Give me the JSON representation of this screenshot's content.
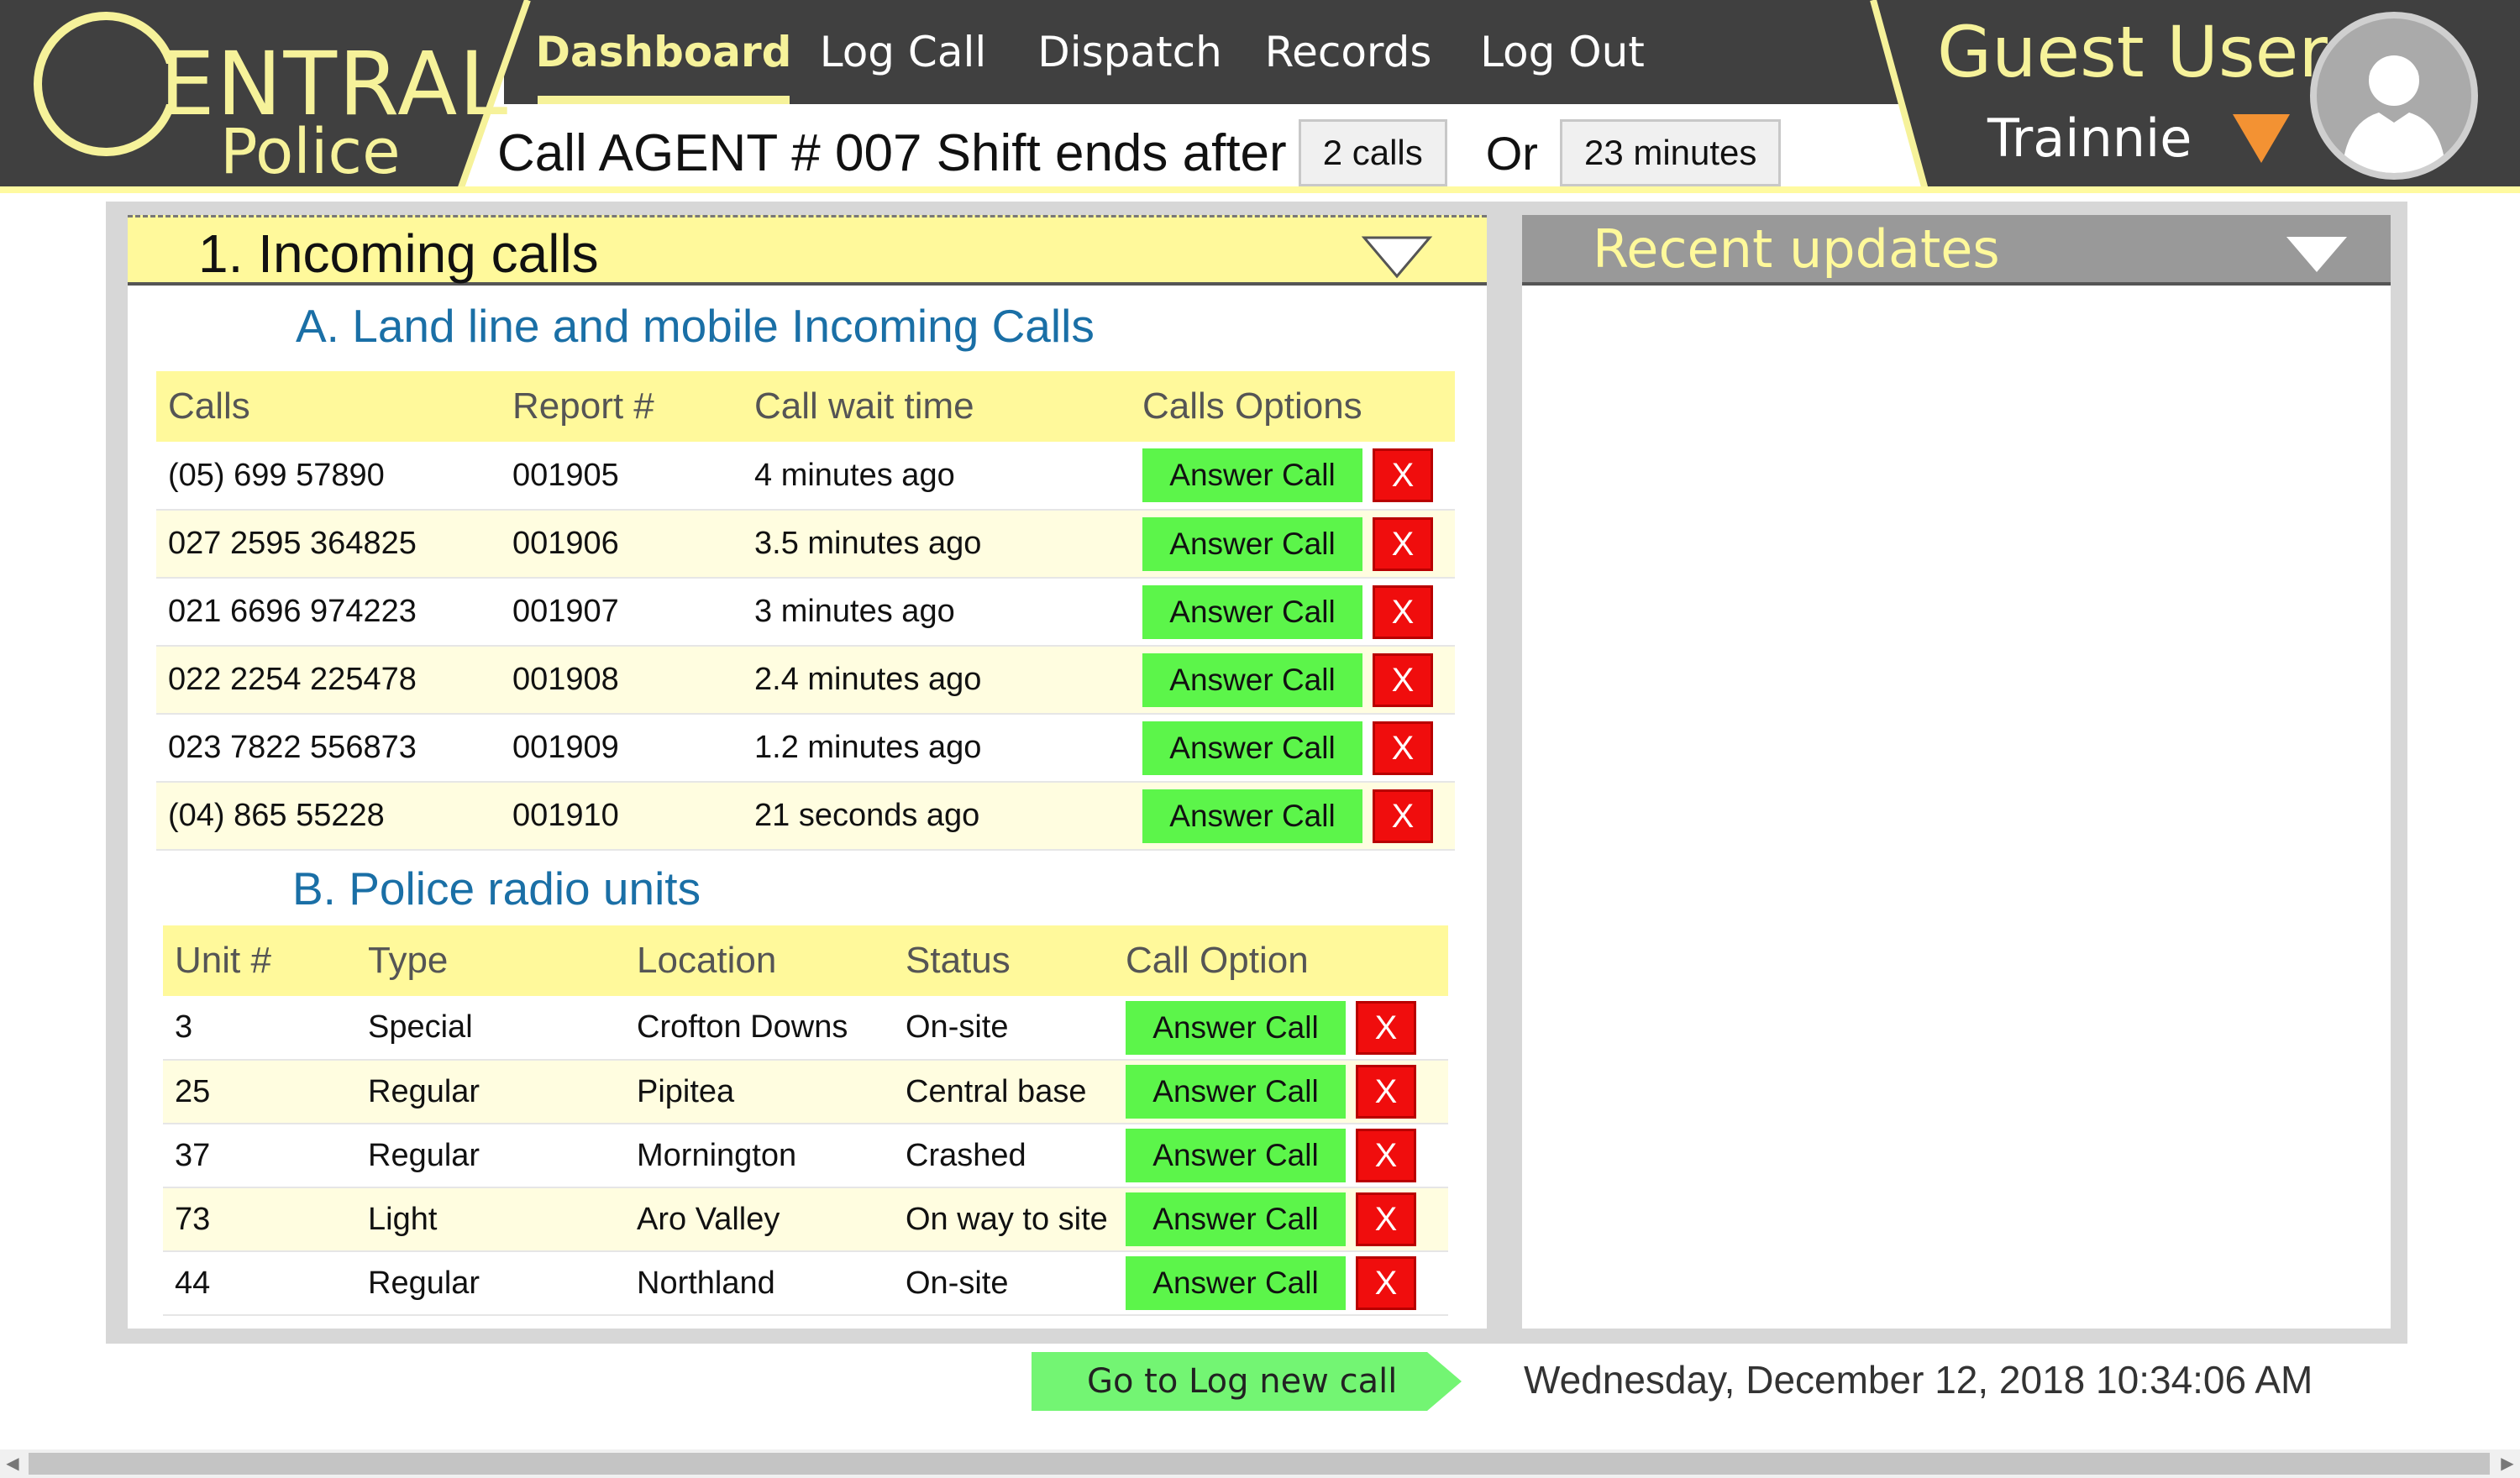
{
  "logo": {
    "text_main": "ENTRAL",
    "text_sub": "Police",
    "full_name": "CENTRAL Police"
  },
  "nav": {
    "items": [
      {
        "label": "Dashboard",
        "active": true
      },
      {
        "label": "Log Call",
        "active": false
      },
      {
        "label": "Dispatch",
        "active": false
      },
      {
        "label": "Records",
        "active": false
      },
      {
        "label": "Log Out",
        "active": false
      }
    ]
  },
  "shift": {
    "text": "Call AGENT # 007 Shift ends after",
    "calls_value": "2 calls",
    "or_label": "Or",
    "minutes_value": "23 minutes"
  },
  "user": {
    "name": "Guest User",
    "role": "Trainnie"
  },
  "incoming": {
    "title": "1. Incoming calls",
    "calls_section": {
      "title": "A. Land line and mobile Incoming Calls",
      "columns": [
        "Calls",
        "Report #",
        "Call wait time",
        "Calls Options"
      ],
      "rows": [
        {
          "number": "(05) 699 57890",
          "report": "001905",
          "wait": "4 minutes ago"
        },
        {
          "number": "027 2595 364825",
          "report": "001906",
          "wait": "3.5 minutes ago"
        },
        {
          "number": "021 6696 974223",
          "report": "001907",
          "wait": "3 minutes ago"
        },
        {
          "number": "022 2254 225478",
          "report": "001908",
          "wait": "2.4 minutes ago"
        },
        {
          "number": "023 7822 556873",
          "report": "001909",
          "wait": "1.2 minutes ago"
        },
        {
          "number": "(04) 865 55228",
          "report": "001910",
          "wait": "21 seconds ago"
        }
      ]
    },
    "radio_section": {
      "title": "B. Police radio units",
      "columns": [
        "Unit #",
        "Type",
        "Location",
        "Status",
        "Call Option"
      ],
      "rows": [
        {
          "unit": "3",
          "type": "Special",
          "location": "Crofton Downs",
          "status": "On-site"
        },
        {
          "unit": "25",
          "type": "Regular",
          "location": "Pipitea",
          "status": "Central base"
        },
        {
          "unit": "37",
          "type": "Regular",
          "location": "Mornington",
          "status": "Crashed"
        },
        {
          "unit": "73",
          "type": "Light",
          "location": "Aro Valley",
          "status": "On way to site"
        },
        {
          "unit": "44",
          "type": "Regular",
          "location": "Northland",
          "status": "On-site"
        }
      ]
    },
    "answer_label": "Answer Call",
    "dismiss_label": "X"
  },
  "updates": {
    "title": "Recent updates"
  },
  "footer": {
    "go_log_label": "Go to Log new call",
    "datetime": "Wednesday, December 12, 2018 10:34:06 AM"
  },
  "icons": {
    "collapse": "triangle-down-icon",
    "user_menu": "dropdown-arrow-icon",
    "avatar": "user-silhouette-icon",
    "scroll_left": "chevron-left-icon",
    "scroll_right": "chevron-right-icon"
  },
  "colors": {
    "header_dark": "#404040",
    "accent_yellow": "#f6f29a",
    "table_header": "#fff99b",
    "answer_green": "#5cf54a",
    "dismiss_red": "#f00d0d",
    "section_blue": "#1a6fa6",
    "dropdown_orange": "#f39233"
  }
}
